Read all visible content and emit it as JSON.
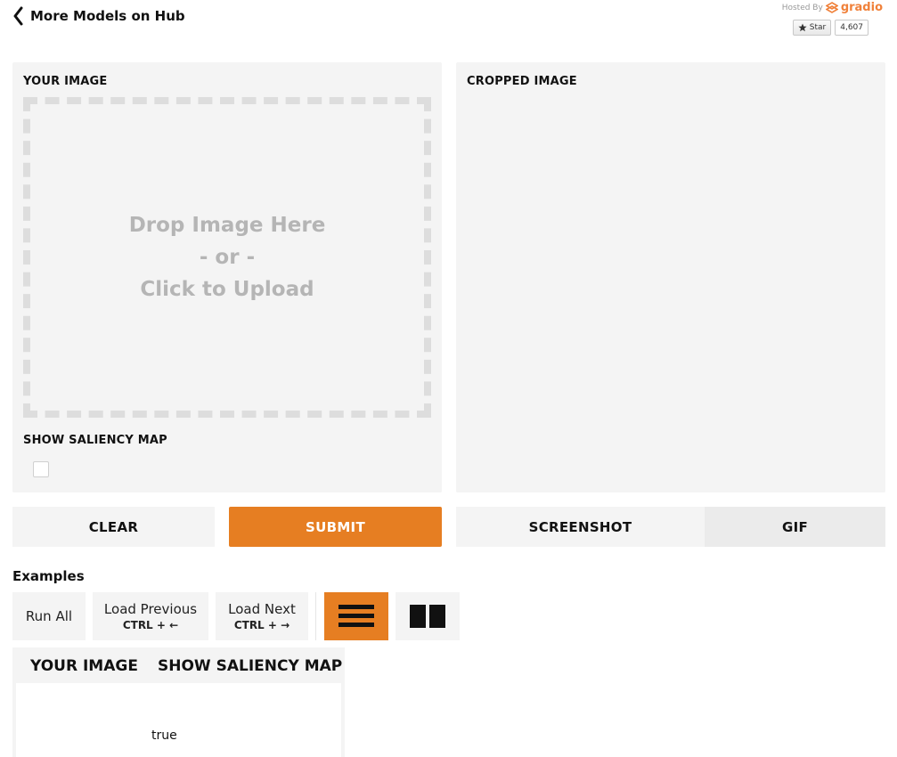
{
  "header": {
    "back_label": "More Models on Hub",
    "hosted_by": "Hosted By",
    "brand": "gradio",
    "star_label": "Star",
    "star_count": "4,607"
  },
  "input_panel": {
    "label": "YOUR IMAGE",
    "dropzone_lines": [
      "Drop Image Here",
      "- or -",
      "Click to Upload"
    ],
    "saliency_label": "SHOW SALIENCY MAP",
    "saliency_checked": false
  },
  "output_panel": {
    "label": "CROPPED IMAGE"
  },
  "actions": {
    "clear": "CLEAR",
    "submit": "SUBMIT",
    "screenshot": "SCREENSHOT",
    "gif": "GIF"
  },
  "examples": {
    "title": "Examples",
    "run_all": "Run All",
    "load_previous": "Load Previous",
    "load_previous_shortcut": "CTRL + ←",
    "load_next": "Load Next",
    "load_next_shortcut": "CTRL + →",
    "columns": [
      "YOUR IMAGE",
      "SHOW SALIENCY MAP"
    ],
    "rows": [
      [
        "",
        "true"
      ]
    ]
  },
  "colors": {
    "accent": "#e67e22",
    "panel": "#f4f4f4",
    "brand": "#f0813a"
  },
  "icons": {
    "back": "chevron-left-icon",
    "star": "star-icon",
    "brand": "gradio-logo-icon",
    "list_view": "list-view-icon",
    "grid_view": "grid-view-icon"
  }
}
